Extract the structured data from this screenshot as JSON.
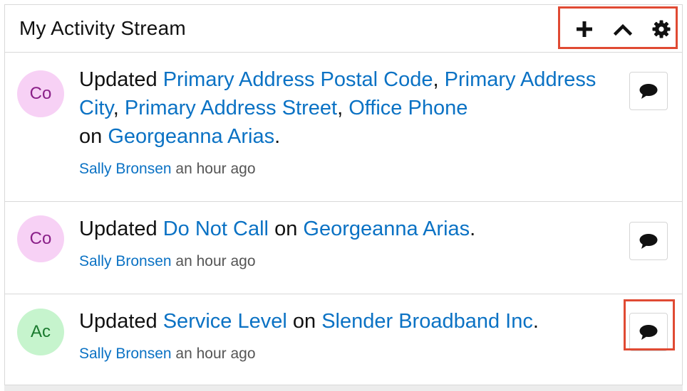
{
  "dashlet": {
    "title": "My Activity Stream",
    "toolbar": {
      "add_icon": "plus-icon",
      "collapse_icon": "chevron-up-icon",
      "settings_icon": "gear-icon"
    }
  },
  "activities": [
    {
      "avatar": "Co",
      "avatar_color": "#f7d1f5",
      "verb": "Updated",
      "fields": [
        "Primary Address Postal Code",
        "Primary Address City",
        "Primary Address Street",
        "Office Phone"
      ],
      "sep": ",",
      "on_word": "on",
      "record": "Georgeanna Arias",
      "end": ".",
      "user": "Sally Bronsen",
      "time": "an hour ago"
    },
    {
      "avatar": "Co",
      "avatar_color": "#f7d1f5",
      "verb": "Updated",
      "fields": [
        "Do Not Call"
      ],
      "on_word": "on",
      "record": "Georgeanna Arias",
      "end": ".",
      "user": "Sally Bronsen",
      "time": "an hour ago"
    },
    {
      "avatar": "Ac",
      "avatar_color": "#c6f4cd",
      "verb": "Updated",
      "fields": [
        "Service Level"
      ],
      "on_word": "on",
      "record": "Slender Broadband Inc",
      "end": ".",
      "user": "Sally Bronsen",
      "time": "an hour ago"
    }
  ],
  "colors": {
    "link": "#0b72c4",
    "highlight": "#e04a33"
  },
  "comment_icon": "comment-bubble-icon"
}
